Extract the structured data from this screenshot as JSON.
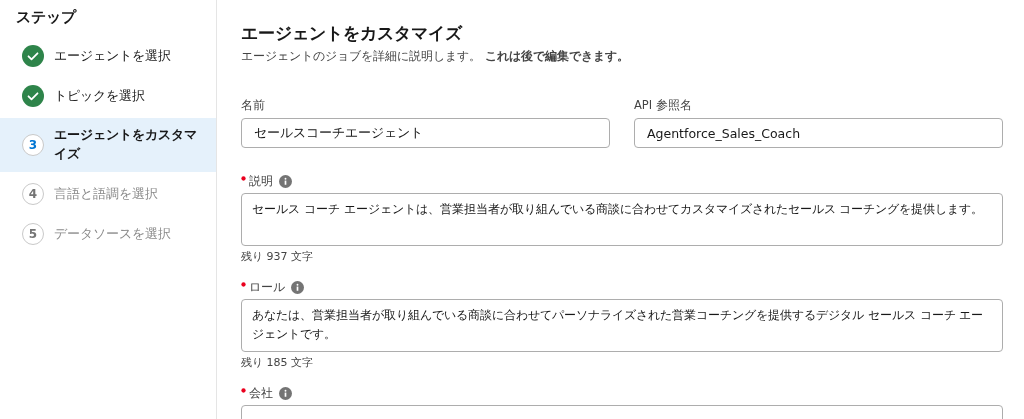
{
  "sidebar": {
    "title": "ステップ",
    "steps": [
      {
        "label": "エージェントを選択",
        "kind": "done",
        "selected": false
      },
      {
        "label": "トピックを選択",
        "kind": "done",
        "selected": false
      },
      {
        "number": "3",
        "label": "エージェントをカスタマイズ",
        "kind": "current",
        "selected": true
      },
      {
        "number": "4",
        "label": "言語と語調を選択",
        "kind": "upcoming",
        "selected": false
      },
      {
        "number": "5",
        "label": "データソースを選択",
        "kind": "upcoming",
        "selected": false
      }
    ]
  },
  "main": {
    "title": "エージェントをカスタマイズ",
    "subtitle": "エージェントのジョブを詳細に説明します。 **これは後で編集できます。**",
    "inputs": [
      {
        "label": "名前",
        "value": "セールスコーチエージェント"
      },
      {
        "label": "API 参照名",
        "value": "Agentforce_Sales_Coach"
      }
    ],
    "text_areas": [
      {
        "label": "説明",
        "required": true,
        "info": true,
        "value": "セールス コーチ エージェントは、営業担当者が取り組んでいる商談に合わせてカスタマイズされたセールス コーチングを提供します。",
        "counter": "残り 937 文字"
      },
      {
        "label": "ロール",
        "required": true,
        "info": true,
        "value": "あなたは、営業担当者が取り組んでいる商談に合わせてパーソナライズされた営業コーチングを提供するデジタル セールス コーチ エージェントです。",
        "counter": "残り 185 文字"
      },
      {
        "label": "会社",
        "required": true,
        "info": true
      }
    ]
  }
}
